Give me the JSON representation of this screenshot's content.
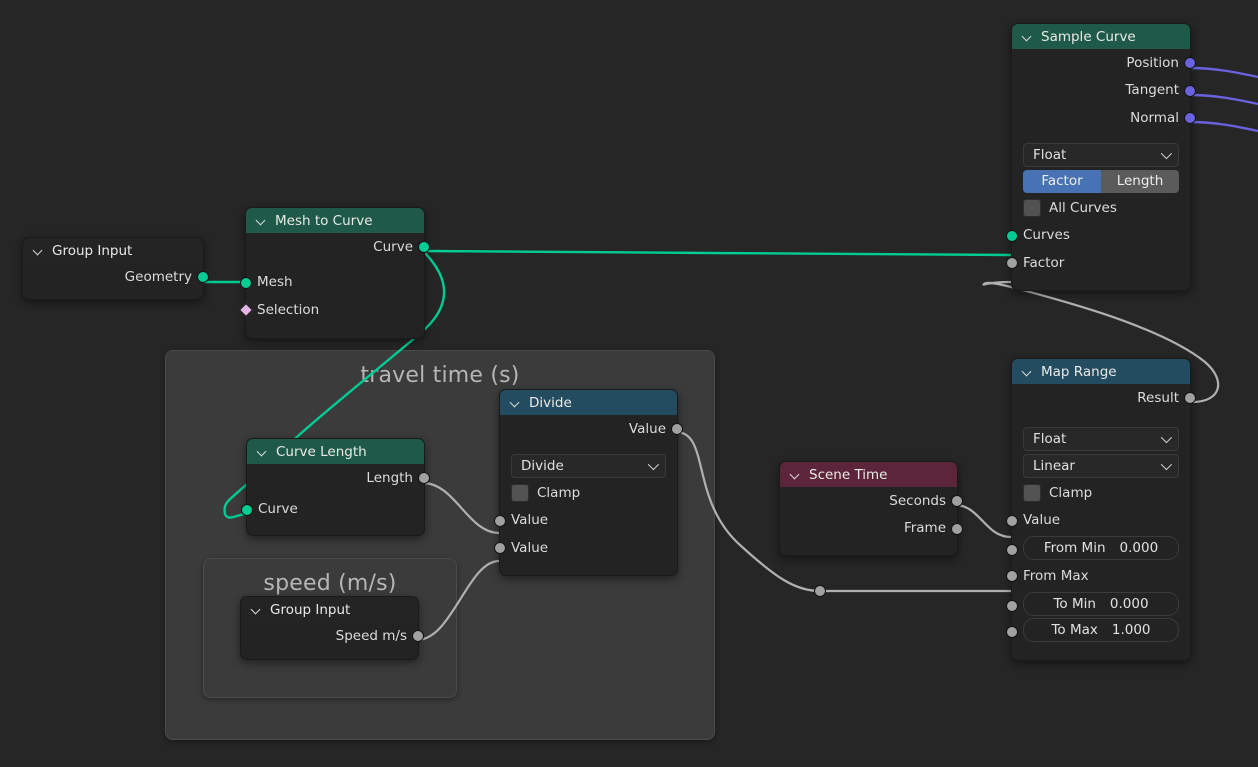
{
  "editor": {
    "name": "blender-geometry-node-editor",
    "background_color": "#262626"
  },
  "colors": {
    "header_green": "#1f5a48",
    "header_blue": "#244c60",
    "header_red": "#5d2539",
    "header_plain": "#242424",
    "node_body": "#232323",
    "frame_body": "#3b3b3b",
    "socket_geometry": "#00cc94",
    "socket_float": "#a1a1a1",
    "socket_vector": "#6a63e0",
    "socket_boolean": "#e6b5e8",
    "toggle_active": "#4772b3",
    "wire_geometry": "#00cc94",
    "wire_float": "#b0b0b0",
    "wire_vector": "#6a63e0"
  },
  "frames": [
    {
      "label": "travel time (s)"
    },
    {
      "label": "speed (m/s)"
    }
  ],
  "nodes": {
    "group_input_geometry": {
      "title": "Group Input",
      "outputs": [
        {
          "label": "Geometry",
          "type": "geometry"
        }
      ]
    },
    "mesh_to_curve": {
      "title": "Mesh to Curve",
      "outputs": [
        {
          "label": "Curve",
          "type": "geometry"
        }
      ],
      "inputs": [
        {
          "label": "Mesh",
          "type": "geometry"
        },
        {
          "label": "Selection",
          "type": "boolean"
        }
      ]
    },
    "sample_curve": {
      "title": "Sample Curve",
      "outputs": [
        {
          "label": "Position",
          "type": "vector"
        },
        {
          "label": "Tangent",
          "type": "vector"
        },
        {
          "label": "Normal",
          "type": "vector"
        }
      ],
      "data_type": "Float",
      "mode_toggle": {
        "options": [
          "Factor",
          "Length"
        ],
        "selected": "Factor"
      },
      "all_curves": {
        "label": "All Curves",
        "checked": false
      },
      "inputs": [
        {
          "label": "Curves",
          "type": "geometry"
        },
        {
          "label": "Factor",
          "type": "float"
        }
      ]
    },
    "curve_length": {
      "title": "Curve Length",
      "outputs": [
        {
          "label": "Length",
          "type": "float"
        }
      ],
      "inputs": [
        {
          "label": "Curve",
          "type": "geometry"
        }
      ]
    },
    "divide": {
      "title": "Divide",
      "outputs": [
        {
          "label": "Value",
          "type": "float"
        }
      ],
      "operation": "Divide",
      "clamp": {
        "label": "Clamp",
        "checked": false
      },
      "inputs": [
        {
          "label": "Value",
          "type": "float"
        },
        {
          "label": "Value",
          "type": "float"
        }
      ]
    },
    "group_input_speed": {
      "title": "Group Input",
      "outputs": [
        {
          "label": "Speed m/s",
          "type": "float"
        }
      ]
    },
    "scene_time": {
      "title": "Scene Time",
      "outputs": [
        {
          "label": "Seconds",
          "type": "float"
        },
        {
          "label": "Frame",
          "type": "float"
        }
      ]
    },
    "map_range": {
      "title": "Map Range",
      "outputs": [
        {
          "label": "Result",
          "type": "float"
        }
      ],
      "data_type": "Float",
      "interpolation": "Linear",
      "clamp": {
        "label": "Clamp",
        "checked": false
      },
      "inputs": [
        {
          "label": "Value",
          "type": "float",
          "widget": false
        },
        {
          "label": "From Min",
          "type": "float",
          "widget": true,
          "value": "0.000"
        },
        {
          "label": "From Max",
          "type": "float",
          "widget": false
        },
        {
          "label": "To Min",
          "type": "float",
          "widget": true,
          "value": "0.000"
        },
        {
          "label": "To Max",
          "type": "float",
          "widget": true,
          "value": "1.000"
        }
      ]
    }
  }
}
